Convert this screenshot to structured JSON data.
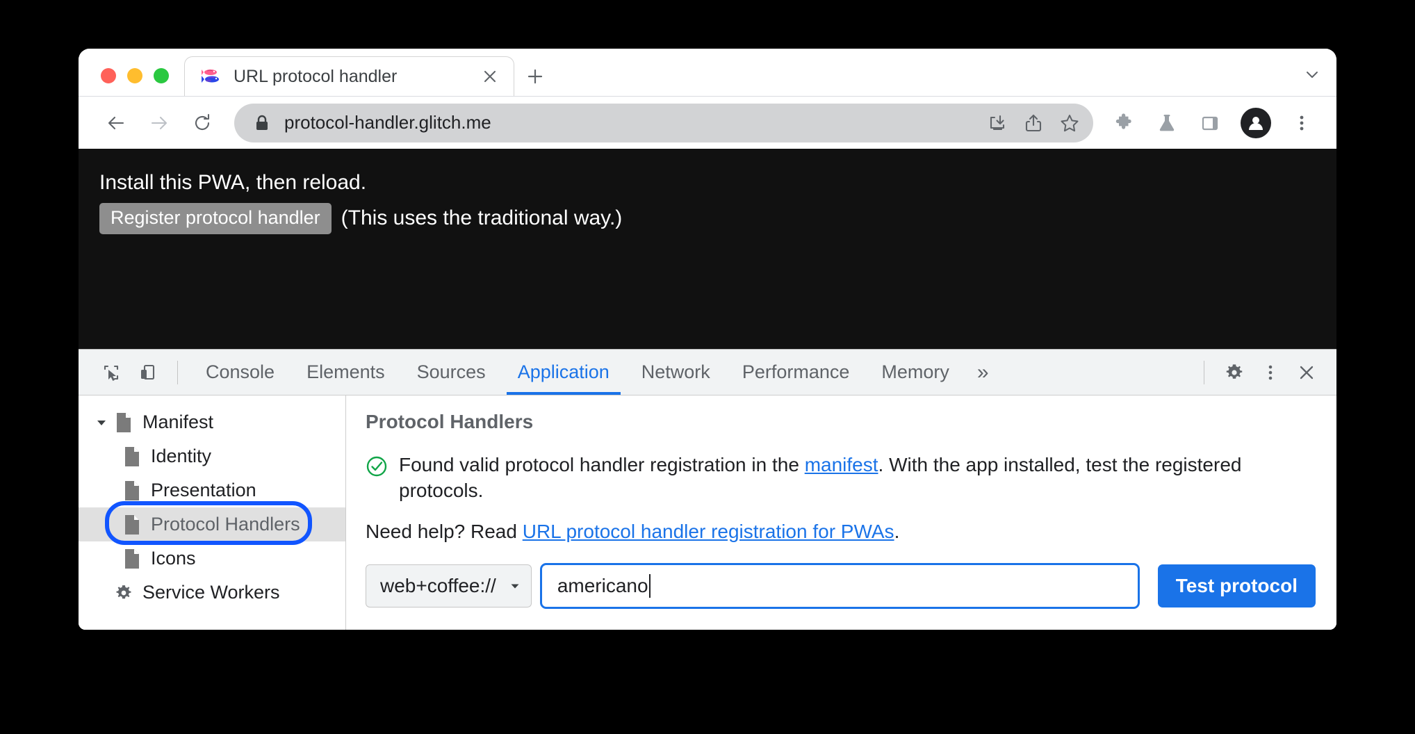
{
  "window": {
    "traffic_lights": [
      "close",
      "minimize",
      "maximize"
    ]
  },
  "tabstrip": {
    "tab": {
      "title": "URL protocol handler",
      "favicon": "glitch-fish-favicon",
      "close_label": "×"
    },
    "new_tab_label": "+",
    "tablist_chevron": "chevron-down-icon"
  },
  "toolbar": {
    "back": "back-arrow-icon",
    "forward": "forward-arrow-icon",
    "reload": "reload-icon",
    "lock": "lock-icon",
    "url": "protocol-handler.glitch.me",
    "install_pwa": "install-pwa-icon",
    "share": "share-icon",
    "bookmark": "star-icon",
    "extensions": "puzzle-icon",
    "experiments": "flask-icon",
    "side_panel": "side-panel-icon",
    "profile": "avatar-icon",
    "menu": "three-dot-menu-icon"
  },
  "page": {
    "heading": "Install this PWA, then reload.",
    "register_button": "Register protocol handler",
    "note": "(This uses the traditional way.)",
    "background": "#111111"
  },
  "devtools": {
    "inspect_icon": "inspect-element-icon",
    "device_icon": "device-toolbar-icon",
    "tabs": [
      {
        "label": "Console",
        "active": false
      },
      {
        "label": "Elements",
        "active": false
      },
      {
        "label": "Sources",
        "active": false
      },
      {
        "label": "Application",
        "active": true
      },
      {
        "label": "Network",
        "active": false
      },
      {
        "label": "Performance",
        "active": false
      },
      {
        "label": "Memory",
        "active": false
      }
    ],
    "more_tabs": "»",
    "settings_icon": "gear-icon",
    "kebab_icon": "three-dot-menu-icon",
    "close_icon": "close-icon",
    "accent_color": "#1a73e8",
    "sidebar": {
      "items": [
        {
          "label": "Manifest",
          "icon": "document-icon",
          "level": 0,
          "expanded": true,
          "selected": false
        },
        {
          "label": "Identity",
          "icon": "document-icon",
          "level": 1,
          "selected": false
        },
        {
          "label": "Presentation",
          "icon": "document-icon",
          "level": 1,
          "selected": false
        },
        {
          "label": "Protocol Handlers",
          "icon": "document-icon",
          "level": 1,
          "selected": true,
          "annotated": true
        },
        {
          "label": "Icons",
          "icon": "document-icon",
          "level": 1,
          "selected": false
        },
        {
          "label": "Service Workers",
          "icon": "gear-icon",
          "level": 0,
          "selected": false
        }
      ],
      "annotation_color": "#1155ff"
    },
    "main": {
      "title": "Protocol Handlers",
      "status_icon": "check-circle-icon",
      "status_color": "#11a548",
      "message_part1": "Found valid protocol handler registration in the ",
      "message_link": "manifest",
      "message_part2": ". With the app installed, test the registered protocols.",
      "help_part1": "Need help? Read ",
      "help_link": "URL protocol handler registration for PWAs",
      "help_part2": ".",
      "scheme_value": "web+coffee://",
      "scheme_caret": "chevron-down-icon",
      "url_value": "americano",
      "url_placeholder": "",
      "test_button": "Test protocol"
    }
  }
}
